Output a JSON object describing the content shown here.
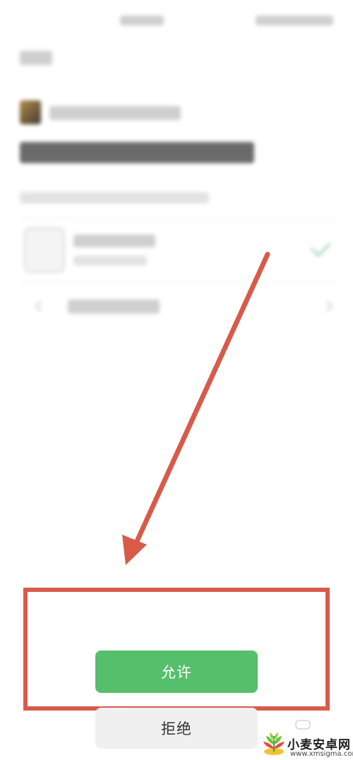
{
  "dialog": {
    "allow_label": "允许",
    "deny_label": "拒绝"
  },
  "annotation": {
    "arrow_color": "#d85b4a",
    "box_color": "#d85b4a"
  },
  "colors": {
    "allow_bg": "#56bf6b",
    "deny_bg": "#f0f0f0"
  },
  "watermark": {
    "title": "小麦安卓网",
    "url": "www.xmsigma.com"
  },
  "icons": {
    "arrow": "arrow-down-left-icon",
    "check": "checkmark-icon",
    "chevron": "chevron-right-icon",
    "logo": "wheat-logo-icon"
  }
}
